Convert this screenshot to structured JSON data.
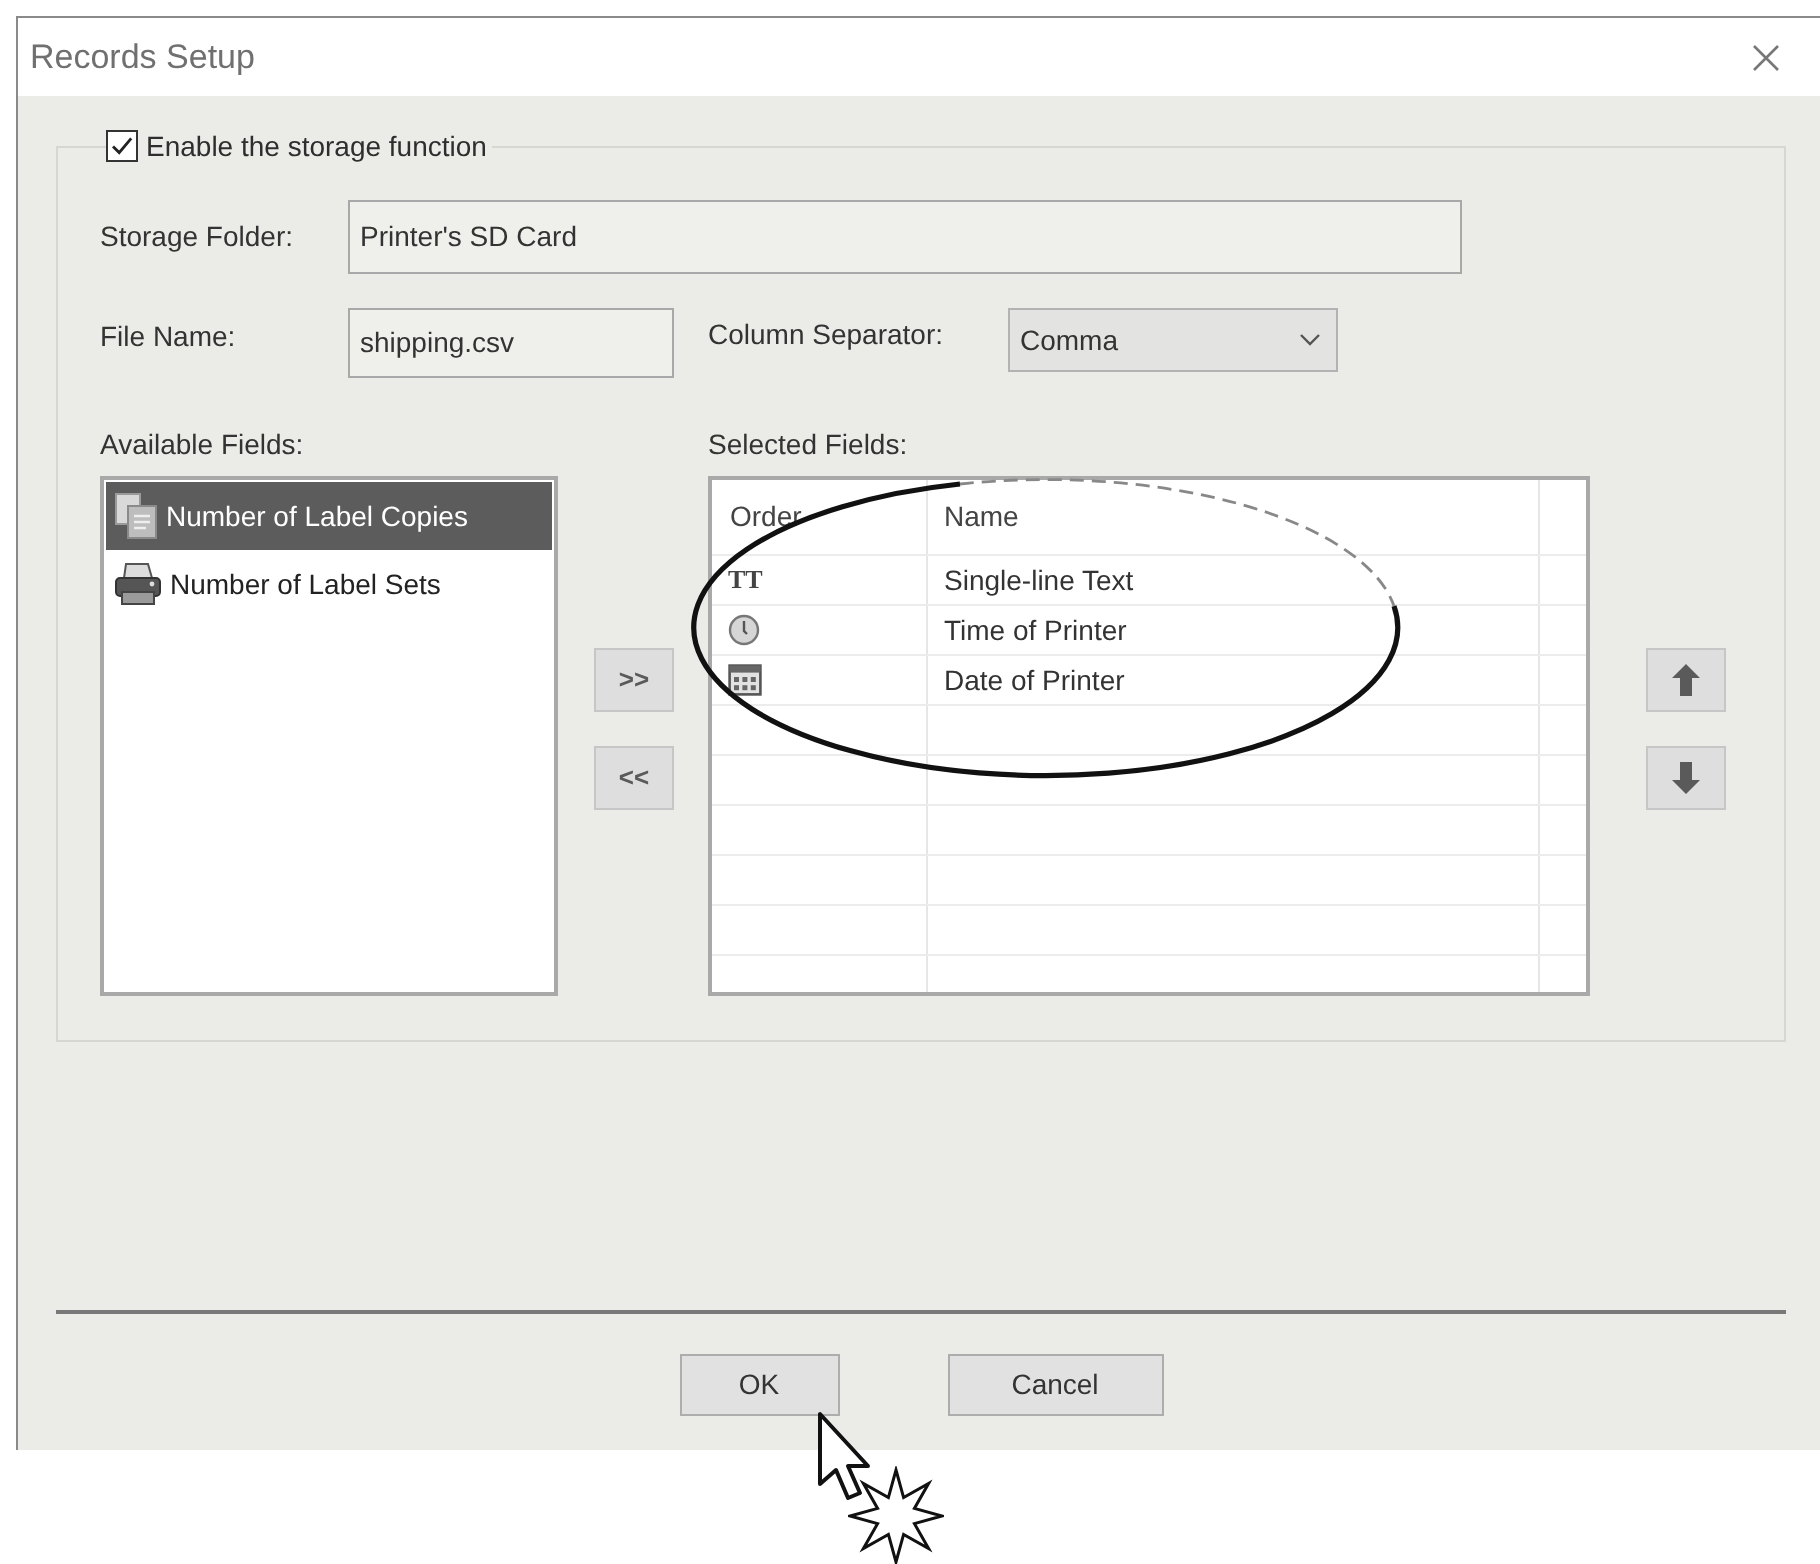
{
  "window": {
    "title": "Records Setup"
  },
  "storage": {
    "enabled": {
      "label": "Enable the storage function",
      "checked": true
    },
    "folder": {
      "label": "Storage Folder:",
      "value": "Printer's SD Card"
    },
    "file_name": {
      "label": "File Name:",
      "value": "shipping.csv"
    },
    "column_separator": {
      "label": "Column Separator:",
      "value": "Comma"
    }
  },
  "available_fields": {
    "label": "Available Fields:",
    "items": [
      {
        "kind": "copies",
        "label": "Number of Label Copies",
        "selected": true
      },
      {
        "kind": "printer",
        "label": "Number of Label Sets",
        "selected": false
      }
    ]
  },
  "transfer_buttons": [
    ">>",
    "<<"
  ],
  "selected_fields": {
    "label": "Selected Fields:",
    "columns": [
      "Order",
      "Name"
    ],
    "rows": [
      {
        "kind": "text",
        "glyph": "TT",
        "name": "Single-line Text"
      },
      {
        "kind": "time",
        "name": "Time of Printer"
      },
      {
        "kind": "date",
        "name": "Date of Printer"
      }
    ]
  },
  "buttons": [
    "OK",
    "Cancel"
  ]
}
